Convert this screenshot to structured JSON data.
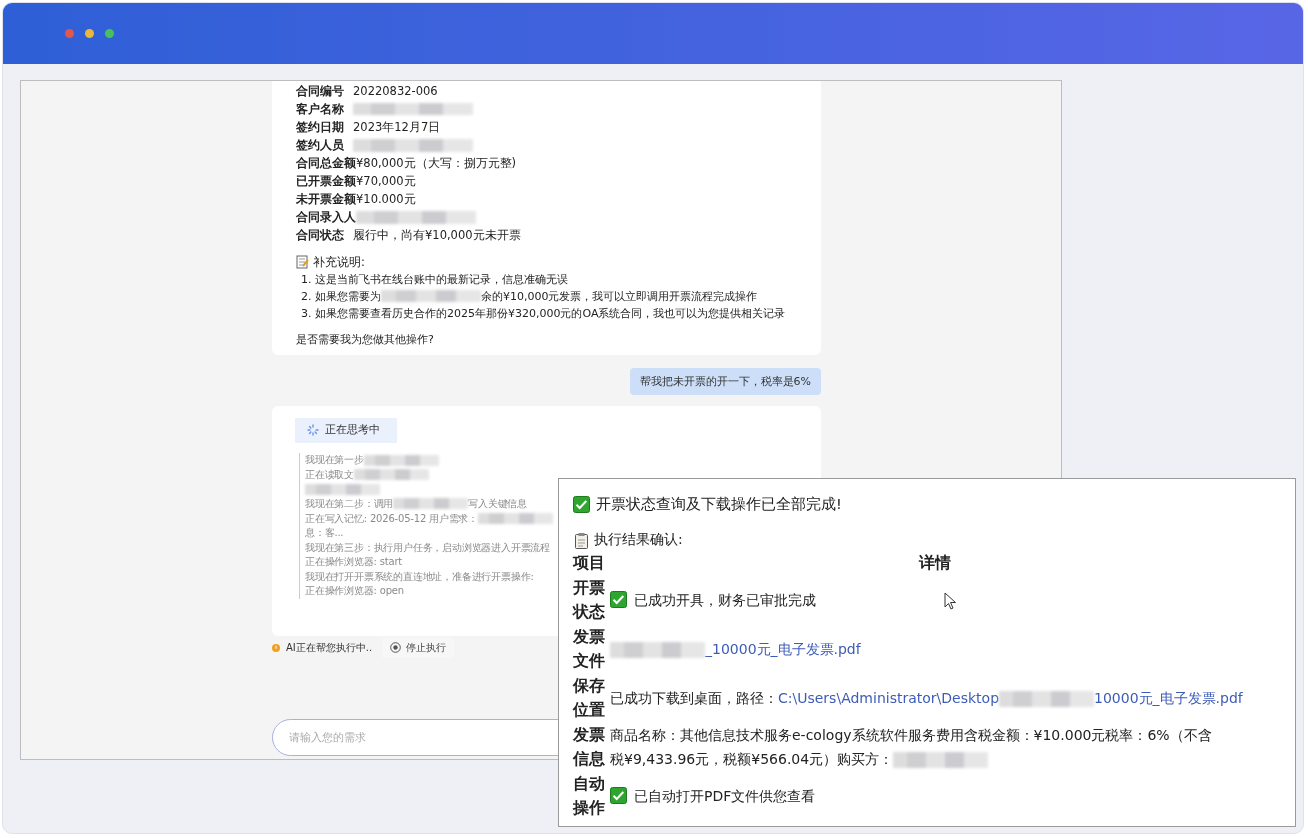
{
  "contract": {
    "fields": [
      {
        "label": "合同编号",
        "segments": [
          {
            "kind": "text",
            "text": "20220832-006"
          }
        ]
      },
      {
        "label": "客户名称",
        "segments": [
          {
            "kind": "blur"
          }
        ]
      },
      {
        "label": "签约日期",
        "segments": [
          {
            "kind": "text",
            "text": "2023年12月7日"
          }
        ]
      },
      {
        "label": "签约人员",
        "segments": [
          {
            "kind": "blur"
          }
        ]
      },
      {
        "label": "合同总金额",
        "segments": [
          {
            "kind": "text",
            "text": "¥80,000元（大写：捌万元整)"
          }
        ]
      },
      {
        "label": "已开票金额",
        "segments": [
          {
            "kind": "text",
            "text": "¥70,000元"
          }
        ]
      },
      {
        "label": "未开票金额",
        "segments": [
          {
            "kind": "text",
            "text": "¥10.000元"
          }
        ]
      },
      {
        "label": "合同录入人",
        "segments": [
          {
            "kind": "blur"
          }
        ]
      },
      {
        "label": "合同状态",
        "segments": [
          {
            "kind": "text",
            "text": "履行中，尚有¥10,000元未开票"
          }
        ]
      }
    ],
    "notes_title": "补充说明:",
    "notes": [
      [
        {
          "kind": "text",
          "text": "1. 这是当前飞书在线台账中的最新记录，信息准确无误"
        }
      ],
      [
        {
          "kind": "text",
          "text": "2. 如果您需要为"
        },
        {
          "kind": "blur"
        },
        {
          "kind": "text",
          "text": "余的¥10,000元发票，我可以立即调用开票流程完成操作"
        }
      ],
      [
        {
          "kind": "text",
          "text": "3. 如果您需要查看历史合作的2025年那份¥320,000元的OA系统合同，我也可以为您提供相关记录"
        }
      ]
    ],
    "question": "是否需要我为您做其他操作?"
  },
  "user_message": "帮我把未开票的开一下，税率是6%",
  "thinking": {
    "badge": "正在思考中",
    "log": [
      [
        {
          "kind": "text",
          "text": "我现在第一步"
        },
        {
          "kind": "blur"
        }
      ],
      [
        {
          "kind": "text",
          "text": "正在读取文"
        },
        {
          "kind": "blur"
        }
      ],
      [
        {
          "kind": "blur"
        }
      ],
      [
        {
          "kind": "text",
          "text": "我现在第二步：调用"
        },
        {
          "kind": "blur"
        },
        {
          "kind": "text",
          "text": "写入关键信息"
        }
      ],
      [
        {
          "kind": "text",
          "text": "正在写入记忆: 2026-05-12 用户需求："
        },
        {
          "kind": "blur"
        }
      ],
      [
        {
          "kind": "text",
          "text": "息：客..."
        }
      ],
      [
        {
          "kind": "text",
          "text": "我现在第三步：执行用户任务，启动浏览器进入开票流程"
        }
      ],
      [
        {
          "kind": "text",
          "text": "正在操作浏览器: start"
        }
      ],
      [
        {
          "kind": "text",
          "text": "我现在打开开票系统的直连地址，准备进行开票操作:"
        }
      ],
      [
        {
          "kind": "text",
          "text": "正在操作浏览器: open"
        }
      ]
    ]
  },
  "status": {
    "text": "AI正在帮您执行中..",
    "stop_button": "停止执行"
  },
  "input": {
    "placeholder": "请输入您的需求"
  },
  "result": {
    "title": "开票状态查询及下载操作已全部完成!",
    "subtitle": "执行结果确认:",
    "columns": [
      "项目",
      "详情"
    ],
    "rows": [
      {
        "item": "开票状态",
        "check": true,
        "detail": [
          {
            "kind": "text",
            "text": "已成功开具，财务已审批完成"
          }
        ]
      },
      {
        "item": "发票文件",
        "check": false,
        "detail": [
          {
            "kind": "blur"
          },
          {
            "kind": "link",
            "text": "_10000元_电子发票.pdf"
          }
        ]
      },
      {
        "item": "保存位置",
        "check": false,
        "detail": [
          {
            "kind": "text",
            "text": "已成功下载到桌面，路径："
          },
          {
            "kind": "link",
            "text": "C:\\Users\\Administrator\\Desktop"
          },
          {
            "kind": "blur"
          },
          {
            "kind": "link",
            "text": "10000元_电子发票.pdf"
          }
        ]
      },
      {
        "item": "发票信息",
        "check": false,
        "detail": [
          {
            "kind": "text",
            "text": "商品名称：其他信息技术服务e-cology系统软件服务费用含税金额：¥10.000元税率：6%（不含"
          },
          {
            "kind": "break"
          },
          {
            "kind": "text",
            "text": "税¥9,433.96元，税额¥566.04元）购买方："
          },
          {
            "kind": "blur"
          }
        ]
      },
      {
        "item": "自动操作",
        "check": true,
        "detail": [
          {
            "kind": "text",
            "text": "已自动打开PDF文件供您查看"
          }
        ]
      }
    ]
  }
}
